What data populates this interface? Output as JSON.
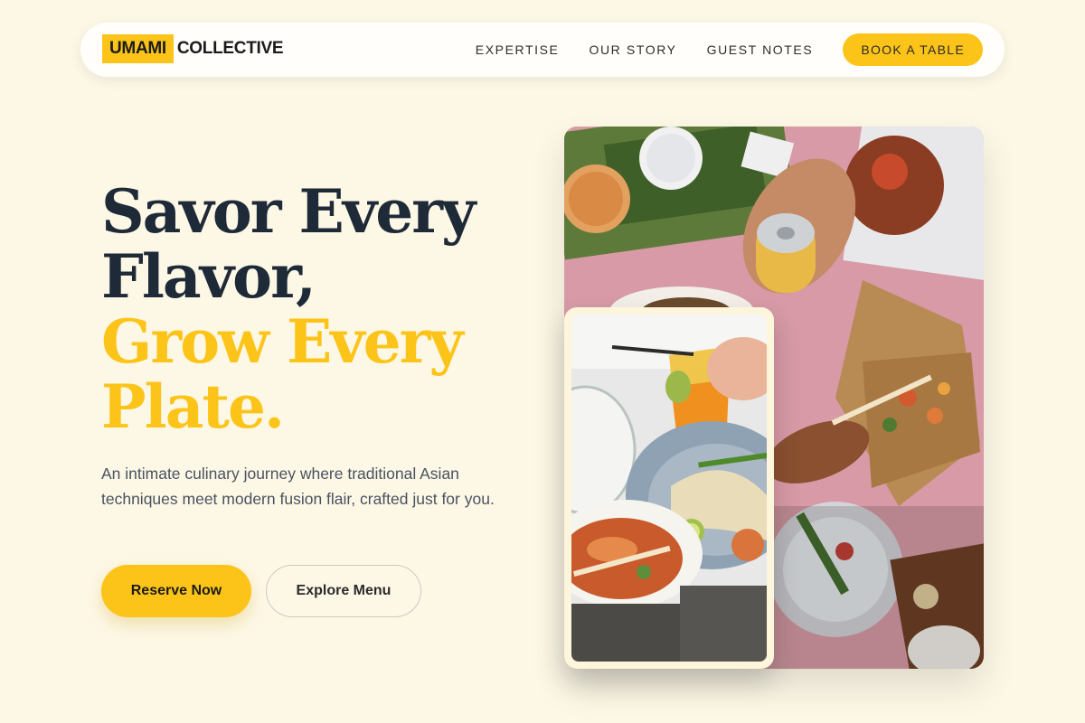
{
  "nav": {
    "brand_highlight": "UMAMI",
    "brand_rest": "COLLECTIVE",
    "links": [
      "EXPERTISE",
      "OUR STORY",
      "GUEST NOTES"
    ],
    "cta": "BOOK A TABLE"
  },
  "hero": {
    "headline_lines": [
      "Savor Every",
      "Flavor,"
    ],
    "headline_accent_lines": [
      "Grow Every",
      "Plate."
    ],
    "subtext": "An intimate culinary journey where traditional Asian techniques meet modern fusion flair, crafted just for you.",
    "primary_button": "Reserve Now",
    "secondary_button": "Explore Menu"
  },
  "images": {
    "main": "overhead-food-table-photo",
    "inset": "soup-drink-plate-photo"
  },
  "colors": {
    "accent": "#fcc419",
    "background": "#fdf8e6",
    "heading": "#1e2a38",
    "body_text": "#4a5261"
  }
}
